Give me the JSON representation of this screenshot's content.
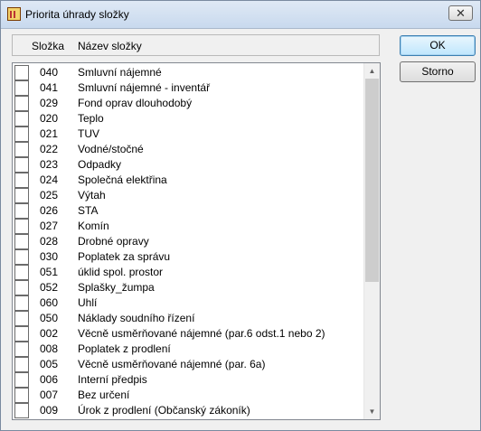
{
  "window": {
    "title": "Priorita úhrady složky",
    "close_label": "✕"
  },
  "header": {
    "col_code": "Složka",
    "col_name": "Název složky"
  },
  "buttons": {
    "ok": "OK",
    "cancel": "Storno"
  },
  "items": [
    {
      "code": "040",
      "name": "Smluvní nájemné"
    },
    {
      "code": "041",
      "name": "Smluvní nájemné - inventář"
    },
    {
      "code": "029",
      "name": "Fond oprav dlouhodobý"
    },
    {
      "code": "020",
      "name": "Teplo"
    },
    {
      "code": "021",
      "name": "TUV"
    },
    {
      "code": "022",
      "name": "Vodné/stočné"
    },
    {
      "code": "023",
      "name": "Odpadky"
    },
    {
      "code": "024",
      "name": "Společná elektřina"
    },
    {
      "code": "025",
      "name": "Výtah"
    },
    {
      "code": "026",
      "name": "STA"
    },
    {
      "code": "027",
      "name": "Komín"
    },
    {
      "code": "028",
      "name": "Drobné opravy"
    },
    {
      "code": "030",
      "name": "Poplatek za správu"
    },
    {
      "code": "051",
      "name": "úklid spol. prostor"
    },
    {
      "code": "052",
      "name": "Splašky_žumpa"
    },
    {
      "code": "060",
      "name": "Uhlí"
    },
    {
      "code": "050",
      "name": "Náklady soudního řízení"
    },
    {
      "code": "002",
      "name": "Věcně usměrňované nájemné (par.6 odst.1 nebo 2)"
    },
    {
      "code": "008",
      "name": "Poplatek z prodlení"
    },
    {
      "code": "005",
      "name": "Věcně usměrňované nájemné (par. 6a)"
    },
    {
      "code": "006",
      "name": "Interní předpis"
    },
    {
      "code": "007",
      "name": "Bez určení"
    },
    {
      "code": "009",
      "name": "Úrok z prodlení (Občanský zákoník)"
    }
  ],
  "scrollbar": {
    "up_icon": "scroll-up-arrow",
    "down_icon": "scroll-down-arrow"
  }
}
